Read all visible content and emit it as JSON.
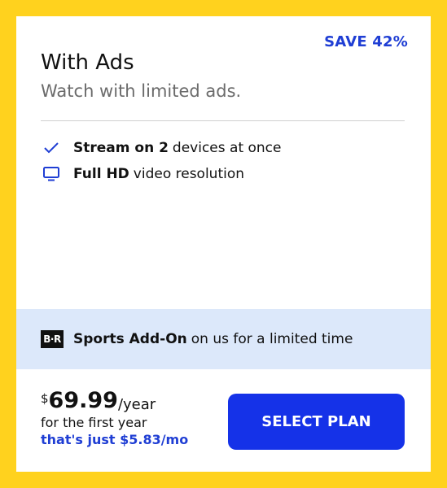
{
  "plan": {
    "badge": "SAVE 42%",
    "title": "With Ads",
    "subtitle": "Watch with limited ads."
  },
  "features": [
    {
      "icon": "checkmark-icon",
      "bold": "Stream on 2",
      "rest": "devices at once"
    },
    {
      "icon": "monitor-icon",
      "bold": "Full HD",
      "rest": "video resolution"
    }
  ],
  "addon": {
    "logo": "B·R",
    "bold": "Sports Add-On",
    "rest": "on us for a limited time"
  },
  "pricing": {
    "currency": "$",
    "amount": "69.99",
    "period": "/year",
    "term": "for the first year",
    "monthly": "that's just $5.83/mo"
  },
  "cta": {
    "label": "SELECT PLAN"
  },
  "colors": {
    "frame": "#FFD21E",
    "accent": "#1F3ED4",
    "button": "#1532E8",
    "addon_bg": "#DCE8FA"
  }
}
